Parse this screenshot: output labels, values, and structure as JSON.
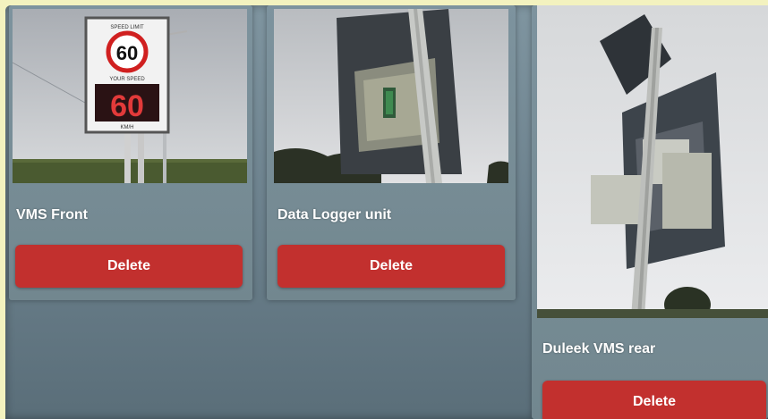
{
  "cards": [
    {
      "title": "VMS Front",
      "delete_label": "Delete"
    },
    {
      "title": "Data Logger unit",
      "delete_label": "Delete"
    },
    {
      "title": "Duleek VMS rear",
      "delete_label": "Delete"
    }
  ],
  "sign": {
    "speed_limit": "60",
    "your_speed_label": "YOUR SPEED",
    "display_speed": "60",
    "small_top": "SPEED LIMIT",
    "small_bottom": "KM/H"
  },
  "colors": {
    "panel": "#72878f",
    "delete_button": "#c2302e",
    "background": "#f3f2bf"
  }
}
